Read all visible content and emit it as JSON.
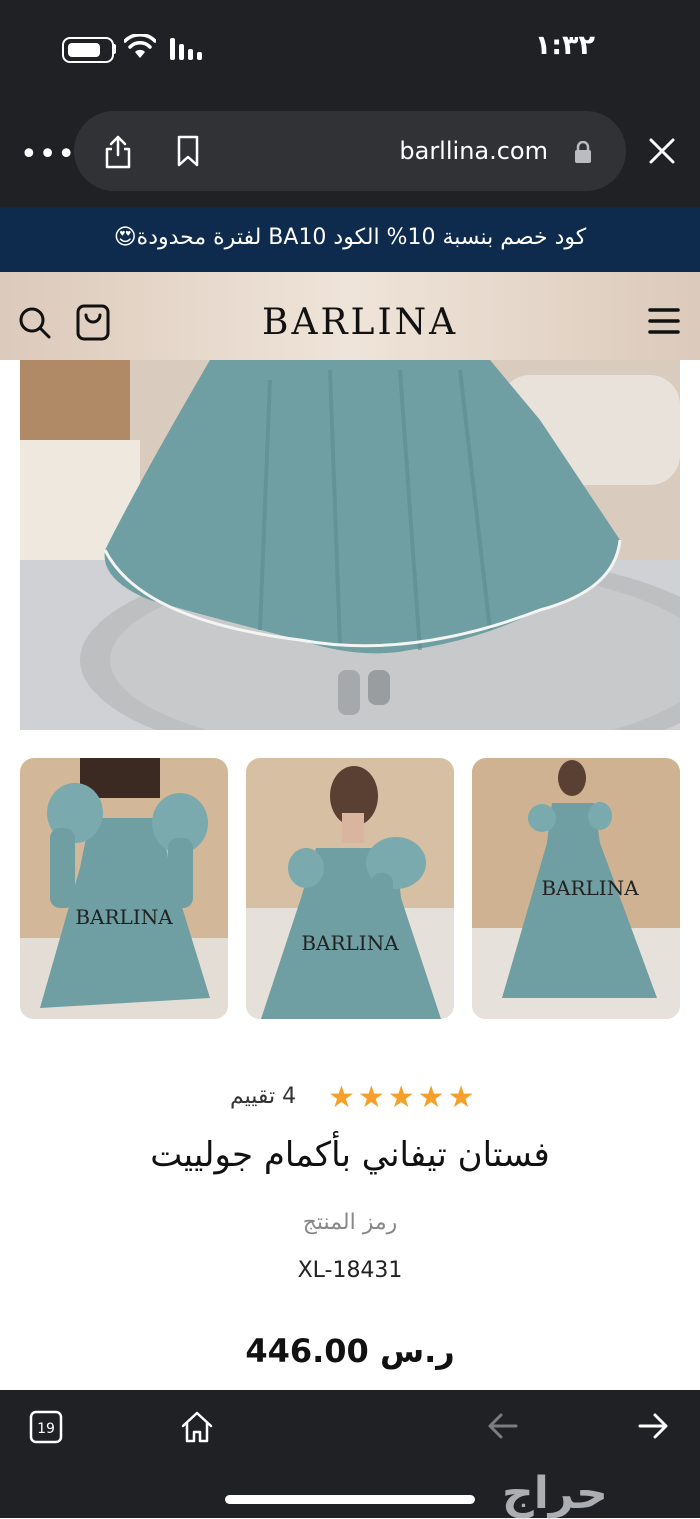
{
  "status_bar": {
    "time": "١:٣٢"
  },
  "browser": {
    "url": "barllina.com",
    "tab_count": "19"
  },
  "promo_banner": {
    "text": "كود خصم بنسبة 10% الكود BA10 لفترة محدودة😍"
  },
  "site": {
    "logo": "BARLINA"
  },
  "product": {
    "rating_stars": "★★★★★",
    "rating_value": 5,
    "rating_count_text": "4 تقييم",
    "title": "فستان تيفاني بأكمام جولييت",
    "sku_label": "رمز المنتج",
    "sku_value": "XL-18431",
    "price": "446.00 ر.س"
  },
  "thumbnails": [
    {
      "watermark": "BARLINA"
    },
    {
      "watermark": "BARLINA"
    },
    {
      "watermark": "BARLINA"
    }
  ],
  "watermark": {
    "text": "حراج"
  },
  "colors": {
    "promo_background": "#0e2a4d",
    "star": "#f6a02c",
    "dress": "#6f9ea3",
    "browser_chrome": "#1f2124"
  }
}
